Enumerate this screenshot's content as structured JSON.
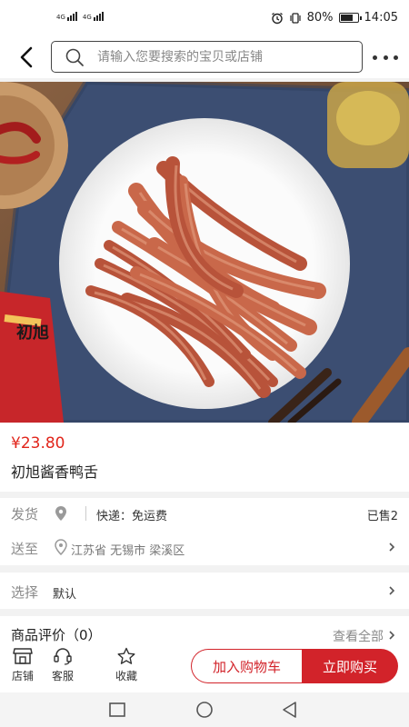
{
  "status_bar": {
    "sim1": "4G",
    "sim2": "4G",
    "battery": "80%",
    "battery_level": 0.8,
    "time": "14:05"
  },
  "header": {
    "back_icon": "chevron-left-icon",
    "search_placeholder": "请输入您要搜索的宝贝或店铺",
    "more_icon": "more-icon"
  },
  "product": {
    "price": "¥23.80",
    "title": "初旭酱香鸭舌",
    "image_brand_text": "初旭"
  },
  "shipping": {
    "label": "发货",
    "delivery": "快递：免运费",
    "sold": "已售2"
  },
  "address": {
    "label": "送至",
    "value": "江苏省 无锡市 梁溪区"
  },
  "options": {
    "label": "选择",
    "value": "默认"
  },
  "reviews": {
    "label": "商品评价（0）",
    "link": "查看全部"
  },
  "tabbar": {
    "store": "店铺",
    "service": "客服",
    "favorite": "收藏",
    "add_cart": "加入购物车",
    "buy_now": "立即购买"
  },
  "colors": {
    "price": "#e1251b",
    "accent": "#d2232a"
  }
}
